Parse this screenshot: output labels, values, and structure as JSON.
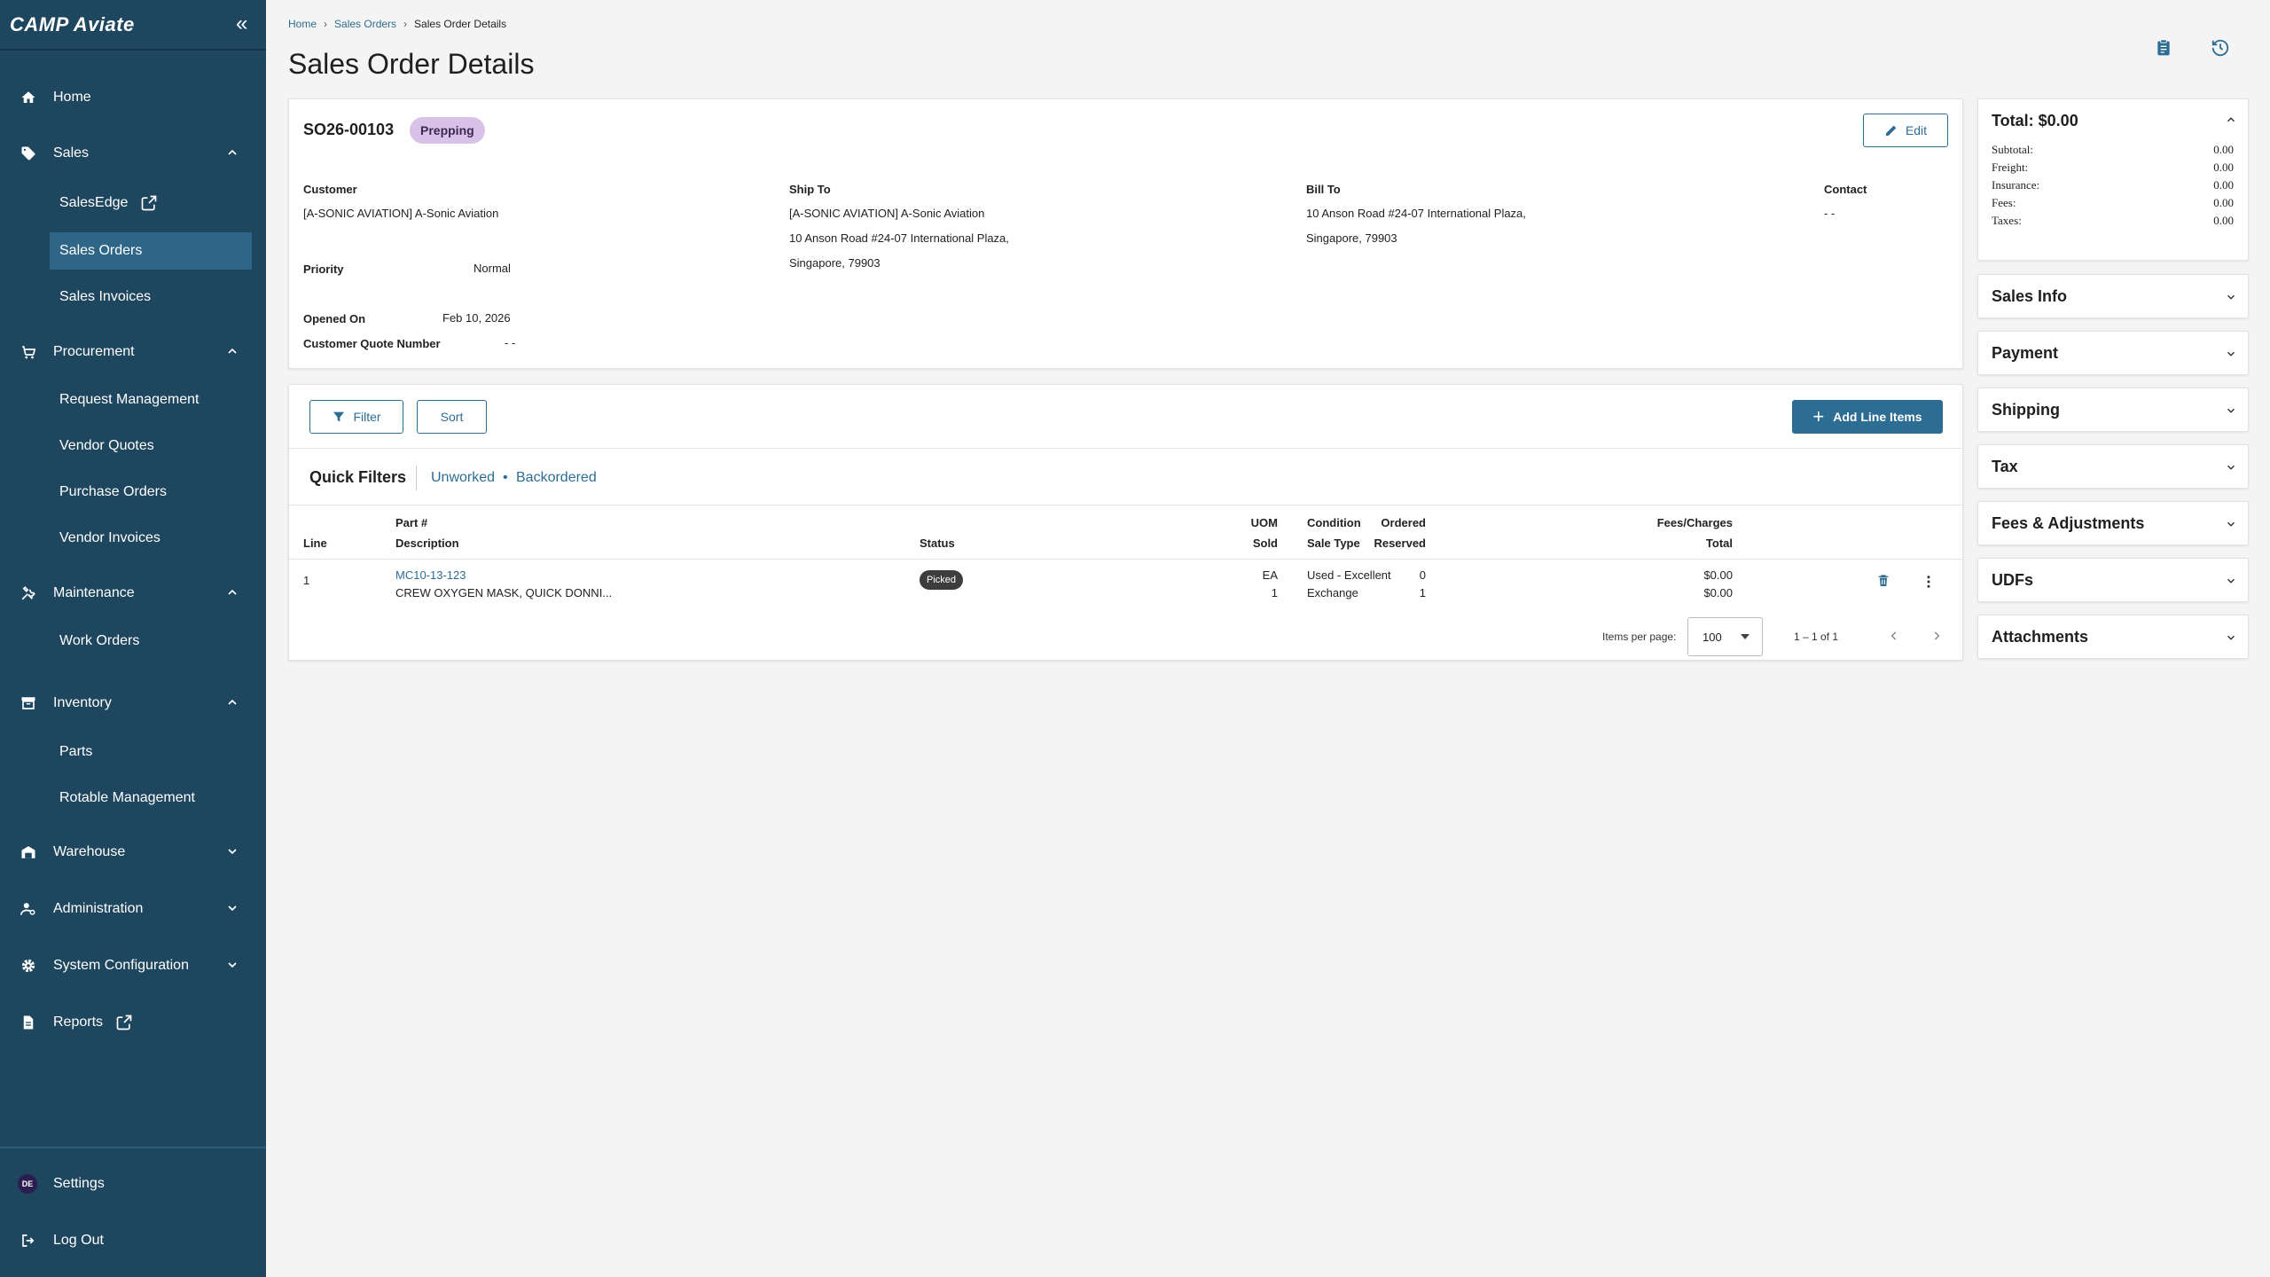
{
  "app": {
    "logo": "CAMP Aviate"
  },
  "sidebar": {
    "home": "Home",
    "sales": {
      "label": "Sales",
      "items": [
        "SalesEdge",
        "Sales Orders",
        "Sales Invoices"
      ]
    },
    "procurement": {
      "label": "Procurement",
      "items": [
        "Request Management",
        "Vendor Quotes",
        "Purchase Orders",
        "Vendor Invoices"
      ]
    },
    "maintenance": {
      "label": "Maintenance",
      "items": [
        "Work Orders"
      ]
    },
    "inventory": {
      "label": "Inventory",
      "items": [
        "Parts",
        "Rotable Management"
      ]
    },
    "warehouse": "Warehouse",
    "administration": "Administration",
    "system_configuration": "System Configuration",
    "reports": "Reports",
    "settings": "Settings",
    "logout": "Log Out",
    "avatar_initials": "DE"
  },
  "breadcrumb": {
    "home": "Home",
    "sales_orders": "Sales Orders",
    "current": "Sales Order Details"
  },
  "page_title": "Sales Order Details",
  "order": {
    "number": "SO26-00103",
    "status": "Prepping",
    "edit_label": "Edit",
    "customer_label": "Customer",
    "customer": "[A-SONIC AVIATION] A-Sonic Aviation",
    "ship_to_label": "Ship To",
    "ship_to": [
      "[A-SONIC AVIATION] A-Sonic Aviation",
      "10 Anson Road #24-07 International Plaza,",
      "Singapore, 79903"
    ],
    "bill_to_label": "Bill To",
    "bill_to": [
      "10 Anson Road #24-07 International Plaza,",
      "Singapore, 79903"
    ],
    "contact_label": "Contact",
    "contact": "- -",
    "priority_label": "Priority",
    "priority": "Normal",
    "opened_on_label": "Opened On",
    "opened_on": "Feb 10, 2026",
    "customer_quote_label": "Customer Quote Number",
    "customer_quote": "- -"
  },
  "lines": {
    "filter_label": "Filter",
    "sort_label": "Sort",
    "add_label": "Add Line Items",
    "quick_filters_label": "Quick Filters",
    "quick_filters": [
      "Unworked",
      "Backordered"
    ],
    "headers": {
      "line": "Line",
      "part": "Part #",
      "description": "Description",
      "status": "Status",
      "uom": "UOM",
      "sold": "Sold",
      "ordered": "Ordered",
      "reserved": "Reserved",
      "condition": "Condition",
      "sale_type": "Sale Type",
      "fees": "Fees/Charges",
      "total": "Total"
    },
    "rows": [
      {
        "line": "1",
        "part": "MC10-13-123",
        "description": "CREW OXYGEN MASK, QUICK DONNI...",
        "status": "Picked",
        "uom": "EA",
        "sold": "1",
        "ordered": "0",
        "reserved": "1",
        "condition": "Used - Excellent",
        "sale_type": "Exchange",
        "fees": "$0.00",
        "total": "$0.00"
      }
    ],
    "items_per_page_label": "Items per page:",
    "items_per_page": "100",
    "range": "1 – 1 of 1"
  },
  "totals": {
    "title": "Total: $0.00",
    "rows": [
      {
        "label": "Subtotal:",
        "value": "0.00"
      },
      {
        "label": "Freight:",
        "value": "0.00"
      },
      {
        "label": "Insurance:",
        "value": "0.00"
      },
      {
        "label": "Fees:",
        "value": "0.00"
      },
      {
        "label": "Taxes:",
        "value": "0.00"
      }
    ]
  },
  "panels": [
    "Sales Info",
    "Payment",
    "Shipping",
    "Tax",
    "Fees & Adjustments",
    "UDFs",
    "Attachments"
  ],
  "colors": {
    "sidebar": "#1e465e",
    "accent": "#2e6d93",
    "active_item": "#2f6688",
    "status_prepping": "#d9c2e8"
  }
}
